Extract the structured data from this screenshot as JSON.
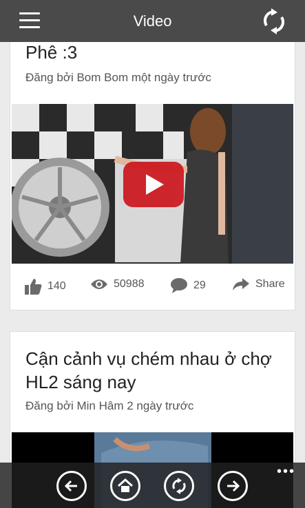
{
  "header": {
    "title": "Video"
  },
  "posts": [
    {
      "title": "Phê :3",
      "meta": "Đăng bởi Bom Bom một ngày trước",
      "likes": "140",
      "views": "50988",
      "comments": "29",
      "share_label": "Share"
    },
    {
      "title": "Cận cảnh vụ chém nhau ở chợ HL2 sáng nay",
      "meta": "Đăng bởi Min Hâm 2 ngày trước"
    }
  ],
  "appbar": {
    "more_label": "•••"
  },
  "colors": {
    "header_bg": "#4a4a4a",
    "play_red": "#cc181e",
    "page_bg": "#ebebeb"
  }
}
